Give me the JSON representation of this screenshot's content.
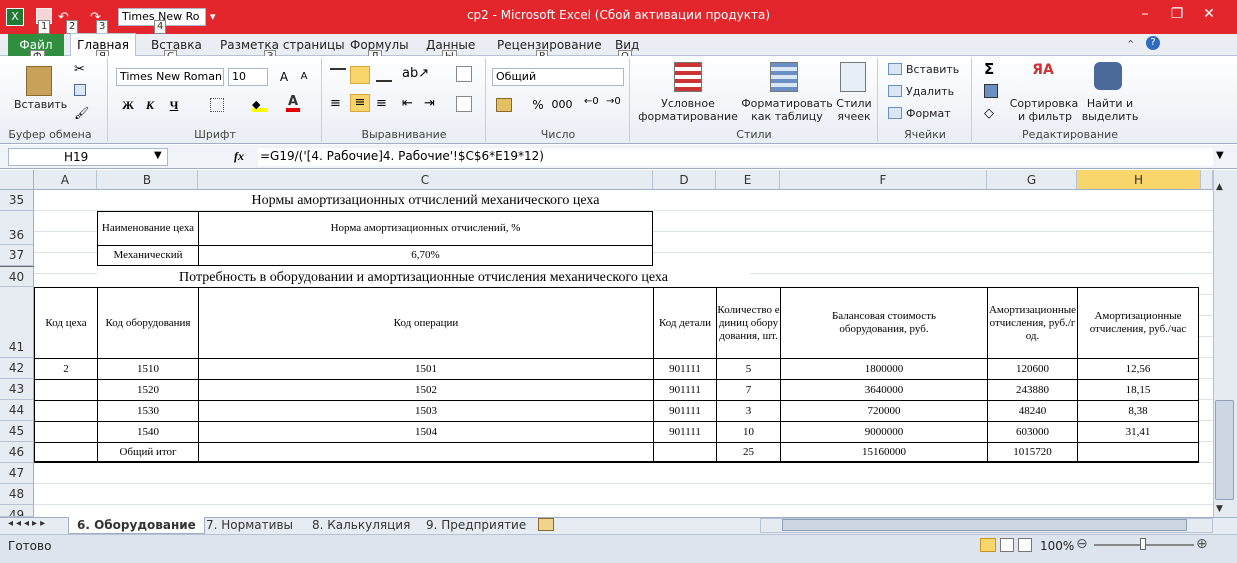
{
  "window": {
    "title": "ср2  -  Microsoft Excel (Сбой активации продукта)",
    "font_qat": "Times New Ro"
  },
  "keytips": {
    "k1": "1",
    "k2": "2",
    "k3": "3",
    "k4": "4"
  },
  "tabs": {
    "file": "Файл",
    "home": "Главная",
    "insert": "Вставка",
    "layout": "Разметка страницы",
    "formulas": "Формулы",
    "data": "Данные",
    "review": "Рецензирование",
    "view": "Вид",
    "kt_file": "Ф",
    "kt_home": "Я",
    "kt_insert": "С",
    "kt_layout": "З",
    "kt_formulas": "Л",
    "kt_data": "Ы",
    "kt_review": "Р",
    "kt_view": "О"
  },
  "ribbon": {
    "paste": "Вставить",
    "clipboard": "Буфер обмена",
    "font_name": "Times New Roman",
    "font_size": "10",
    "font_group": "Шрифт",
    "bold": "Ж",
    "italic": "К",
    "underline": "Ч",
    "align_group": "Выравнивание",
    "number_format": "Общий",
    "percent": "%",
    "thousands": "000",
    "number_group": "Число",
    "cond_format_1": "Условное",
    "cond_format_2": "форматирование",
    "format_table_1": "Форматировать",
    "format_table_2": "как таблицу",
    "cell_styles_1": "Стили",
    "cell_styles_2": "ячеек",
    "styles_group": "Стили",
    "insert_cells": "Вставить",
    "delete_cells": "Удалить",
    "format_cells": "Формат",
    "cells_group": "Ячейки",
    "sort_1": "Сортировка",
    "sort_2": "и фильтр",
    "find_1": "Найти и",
    "find_2": "выделить",
    "editing_group": "Редактирование"
  },
  "formula_bar": {
    "name_box": "H19",
    "fx": "fx",
    "formula": "=G19/('[4. Рабочие]4. Рабочие'!$C$6*E19*12)"
  },
  "columns": [
    "A",
    "B",
    "C",
    "D",
    "E",
    "F",
    "G",
    "H"
  ],
  "rows": [
    "35",
    "36",
    "37",
    "40",
    "41",
    "42",
    "43",
    "44",
    "45",
    "46",
    "47",
    "48",
    "49"
  ],
  "table1": {
    "title": "Нормы амортизационных отчислений механического цеха",
    "h1": "Наименование цеха",
    "h2": "Норма амортизационных отчислений, %",
    "r1c1": "Механический",
    "r1c2": "6,70%"
  },
  "table2": {
    "title": "Потребность в оборудовании и амортизационные отчисления механического цеха",
    "headers": [
      "Код цеха",
      "Код оборудования",
      "Код операции",
      "Код детали",
      "Количество единиц оборудования, шт.",
      "Балансовая стоимость оборудования, руб.",
      "Амортизационные отчисления, руб./год.",
      "Амортизационные отчисления, руб./час"
    ],
    "rows": [
      [
        "2",
        "1510",
        "1501",
        "901111",
        "5",
        "1800000",
        "120600",
        "12,56"
      ],
      [
        "",
        "1520",
        "1502",
        "901111",
        "7",
        "3640000",
        "243880",
        "18,15"
      ],
      [
        "",
        "1530",
        "1503",
        "901111",
        "3",
        "720000",
        "48240",
        "8,38"
      ],
      [
        "",
        "1540",
        "1504",
        "901111",
        "10",
        "9000000",
        "603000",
        "31,41"
      ]
    ],
    "total": [
      "",
      "Общий итог",
      "",
      "",
      "25",
      "15160000",
      "1015720",
      ""
    ]
  },
  "sheets": [
    "6. Оборудование",
    "7. Нормативы",
    "8. Калькуляция",
    "9. Предприятие"
  ],
  "status": {
    "ready": "Готово",
    "zoom": "100%"
  }
}
